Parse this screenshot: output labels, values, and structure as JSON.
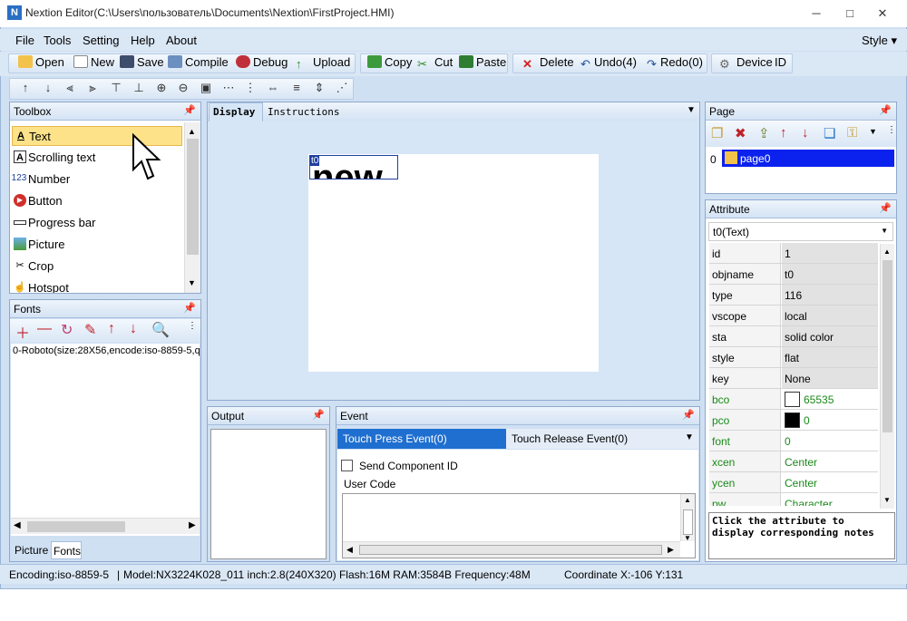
{
  "window": {
    "title": "Nextion Editor(C:\\Users\\пользователь\\Documents\\Nextion\\FirstProject.HMI)",
    "app_icon": "app-icon"
  },
  "menu": {
    "items": [
      "File",
      "Tools",
      "Setting",
      "Help",
      "About"
    ],
    "style_label": "Style"
  },
  "toolbar": {
    "open": "Open",
    "new": "New",
    "save": "Save",
    "compile": "Compile",
    "debug": "Debug",
    "upload": "Upload",
    "copy": "Copy",
    "cut": "Cut",
    "paste": "Paste",
    "delete": "Delete",
    "undo": "Undo(4)",
    "redo": "Redo(0)",
    "device": "Device",
    "id": "ID"
  },
  "toolbox": {
    "title": "Toolbox",
    "items": [
      {
        "label": "Text",
        "icon": "text-icon",
        "selected": true
      },
      {
        "label": "Scrolling text",
        "icon": "scrolling-text-icon"
      },
      {
        "label": "Number",
        "icon": "number-icon"
      },
      {
        "label": "Button",
        "icon": "button-icon"
      },
      {
        "label": "Progress bar",
        "icon": "progress-bar-icon"
      },
      {
        "label": "Picture",
        "icon": "picture-icon"
      },
      {
        "label": "Crop",
        "icon": "crop-icon"
      },
      {
        "label": "Hotspot",
        "icon": "hotspot-icon"
      }
    ]
  },
  "fonts": {
    "title": "Fonts",
    "entry": "0-Roboto(size:28X56,encode:iso-8859-5,qyt",
    "tab_picture": "Picture",
    "tab_fonts": "Fonts"
  },
  "editor": {
    "tab_display": "Display",
    "tab_instructions": "Instructions",
    "component_id": "t0",
    "component_text": "new"
  },
  "output": {
    "title": "Output"
  },
  "event": {
    "title": "Event",
    "tab_press": "Touch Press Event(0)",
    "tab_release": "Touch Release Event(0)",
    "send_component_id": "Send Component ID",
    "user_code": "User Code"
  },
  "page_panel": {
    "title": "Page",
    "index": "0",
    "page_name": "page0"
  },
  "attribute": {
    "title": "Attribute",
    "selected": "t0(Text)",
    "rows": [
      {
        "key": "id",
        "value": "1"
      },
      {
        "key": "objname",
        "value": "t0"
      },
      {
        "key": "type",
        "value": "116"
      },
      {
        "key": "vscope",
        "value": "local"
      },
      {
        "key": "sta",
        "value": "solid color"
      },
      {
        "key": "style",
        "value": "flat"
      },
      {
        "key": "key",
        "value": "None"
      },
      {
        "key": "bco",
        "value": "65535"
      },
      {
        "key": "pco",
        "value": "0"
      },
      {
        "key": "font",
        "value": "0"
      },
      {
        "key": "xcen",
        "value": "Center"
      },
      {
        "key": "ycen",
        "value": "Center"
      },
      {
        "key": "pw",
        "value": "Character"
      }
    ],
    "note": "Click the attribute to display corresponding notes"
  },
  "status": {
    "encoding": "Encoding:iso-8859-5",
    "model": "Model:NX3224K028_011  inch:2.8(240X320) Flash:16M RAM:3584B Frequency:48M",
    "coordinate": "Coordinate X:-106  Y:131"
  },
  "colors": {
    "accent": "#0f5bd6",
    "selection": "#fde289",
    "bco_swatch": "#ffffff",
    "pco_swatch": "#000000"
  }
}
